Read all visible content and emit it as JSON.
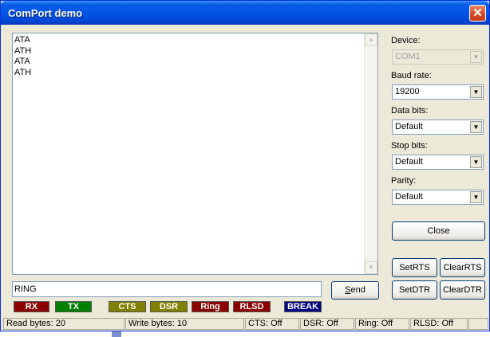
{
  "window": {
    "title": "ComPort demo"
  },
  "memo": {
    "lines": [
      "ATA",
      "ATH",
      "ATA",
      "ATH"
    ]
  },
  "settings": {
    "device": {
      "label": "Device:",
      "value": "COM1"
    },
    "baud": {
      "label": "Baud rate:",
      "value": "19200"
    },
    "databits": {
      "label": "Data bits:",
      "value": "Default"
    },
    "stopbits": {
      "label": "Stop bits:",
      "value": "Default"
    },
    "parity": {
      "label": "Parity:",
      "value": "Default"
    }
  },
  "buttons": {
    "close": "Close",
    "setrts": "SetRTS",
    "clearrts": "ClearRTS",
    "setdtr": "SetDTR",
    "cleardtr": "ClearDTR",
    "send_prefix": "S",
    "send_rest": "end"
  },
  "input": {
    "value": "RING"
  },
  "leds": [
    {
      "label": "RX",
      "color": "#8b0000"
    },
    {
      "label": "TX",
      "color": "#008000"
    },
    {
      "label": "CTS",
      "color": "#808000"
    },
    {
      "label": "DSR",
      "color": "#808000"
    },
    {
      "label": "Ring",
      "color": "#8b0000"
    },
    {
      "label": "RLSD",
      "color": "#8b0000"
    },
    {
      "label": "BREAK",
      "color": "#000080"
    }
  ],
  "status": {
    "read": "Read bytes: 20",
    "write": "Write bytes: 10",
    "cts": "CTS: Off",
    "dsr": "DSR: Off",
    "ring": "Ring: Off",
    "rlsd": "RLSD: Off"
  },
  "icons": {
    "close": "close-x-icon",
    "dropdown": "chevron-down-icon"
  }
}
